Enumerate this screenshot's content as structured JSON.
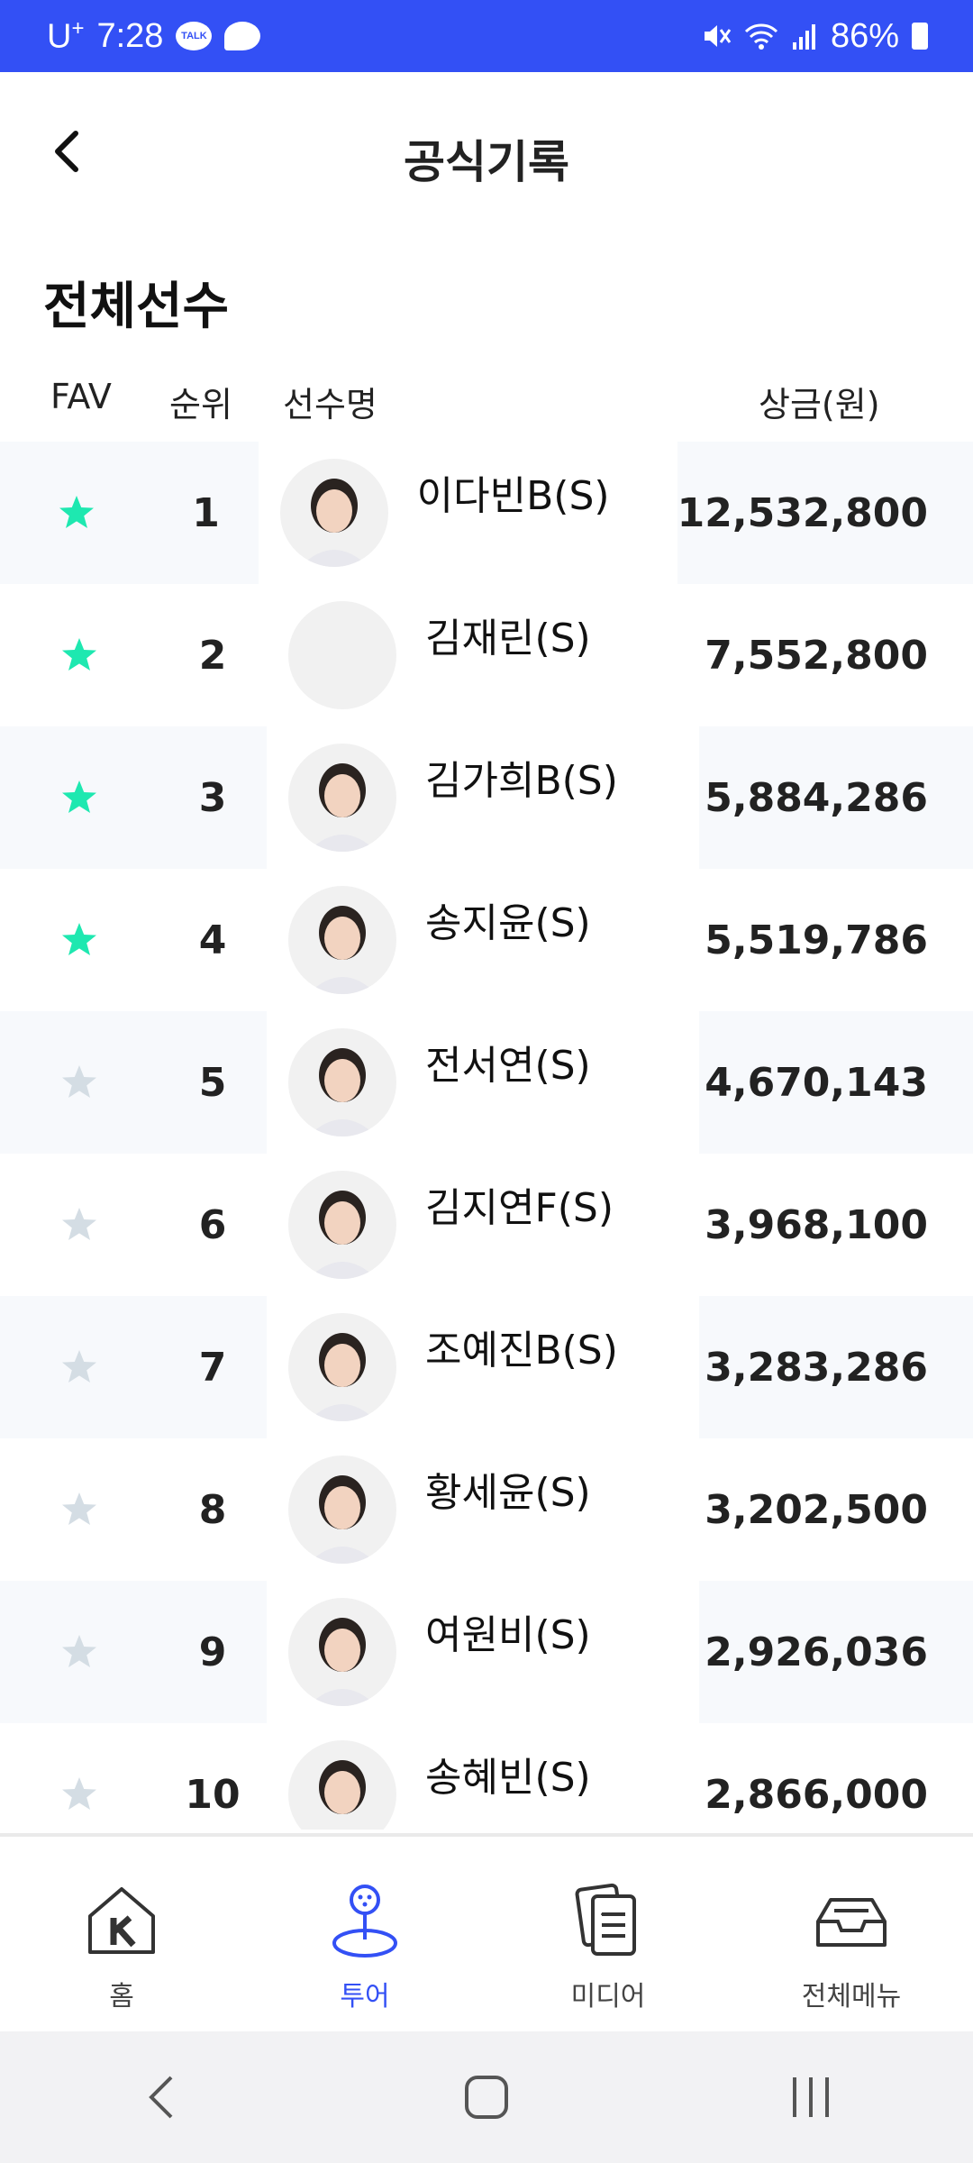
{
  "status_bar": {
    "carrier": "U",
    "carrier_sup": "+",
    "time": "7:28",
    "talk_badge": "TALK",
    "battery": "86%"
  },
  "header": {
    "title": "공식기록"
  },
  "section_title": "전체선수",
  "table": {
    "columns": [
      "FAV",
      "순위",
      "선수명",
      "상금(원)"
    ],
    "rows": [
      {
        "fav": true,
        "rank": "1",
        "name": "이다빈B(S)",
        "prize": "12,532,800",
        "avatar": "photo"
      },
      {
        "fav": true,
        "rank": "2",
        "name": "김재린(S)",
        "prize": "7,552,800",
        "avatar": "empty"
      },
      {
        "fav": true,
        "rank": "3",
        "name": "김가희B(S)",
        "prize": "5,884,286",
        "avatar": "photo"
      },
      {
        "fav": true,
        "rank": "4",
        "name": "송지윤(S)",
        "prize": "5,519,786",
        "avatar": "photo"
      },
      {
        "fav": false,
        "rank": "5",
        "name": "전서연(S)",
        "prize": "4,670,143",
        "avatar": "photo"
      },
      {
        "fav": false,
        "rank": "6",
        "name": "김지연F(S)",
        "prize": "3,968,100",
        "avatar": "photo"
      },
      {
        "fav": false,
        "rank": "7",
        "name": "조예진B(S)",
        "prize": "3,283,286",
        "avatar": "photo"
      },
      {
        "fav": false,
        "rank": "8",
        "name": "황세윤(S)",
        "prize": "3,202,500",
        "avatar": "photo"
      },
      {
        "fav": false,
        "rank": "9",
        "name": "여원비(S)",
        "prize": "2,926,036",
        "avatar": "photo"
      },
      {
        "fav": false,
        "rank": "10",
        "name": "송혜빈(S)",
        "prize": "2,866,000",
        "avatar": "photo"
      }
    ]
  },
  "bottom_nav": [
    {
      "label": "홈",
      "icon": "home-icon",
      "active": false
    },
    {
      "label": "투어",
      "icon": "tour-icon",
      "active": true
    },
    {
      "label": "미디어",
      "icon": "media-icon",
      "active": false
    },
    {
      "label": "전체메뉴",
      "icon": "menu-tray-icon",
      "active": false
    }
  ],
  "colors": {
    "accent": "#3350f5",
    "star_on": "#1ee8b0",
    "star_off": "#d4dde4",
    "row_shade": "#f7f9fc"
  }
}
